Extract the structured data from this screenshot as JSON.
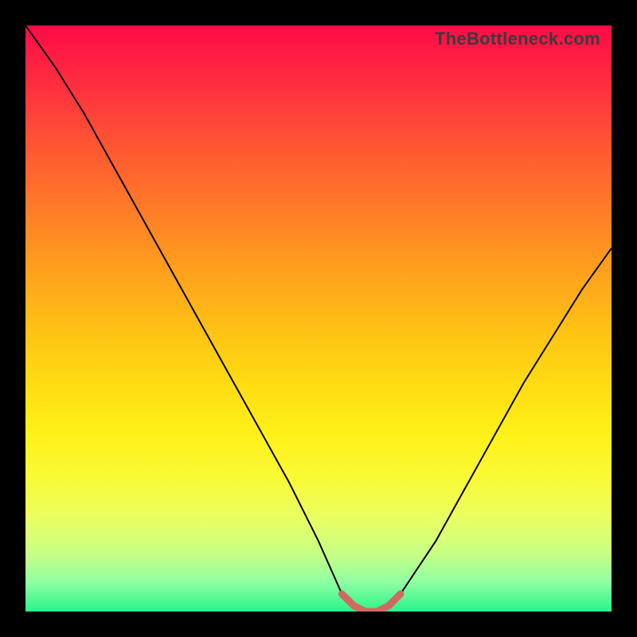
{
  "watermark": "TheBottleneck.com",
  "chart_data": {
    "type": "line",
    "title": "",
    "xlabel": "",
    "ylabel": "",
    "xlim": [
      0,
      100
    ],
    "ylim": [
      0,
      100
    ],
    "series": [
      {
        "name": "main-curve",
        "x": [
          0,
          5,
          10,
          15,
          20,
          25,
          30,
          35,
          40,
          45,
          50,
          54,
          56,
          58,
          60,
          62,
          64,
          70,
          75,
          80,
          85,
          90,
          95,
          100
        ],
        "y": [
          100,
          93,
          85,
          76,
          67,
          58,
          49,
          40,
          31,
          22,
          12,
          3,
          1,
          0,
          0,
          1,
          3,
          12,
          21,
          30,
          39,
          47,
          55,
          62
        ]
      },
      {
        "name": "flat-segment",
        "x": [
          54,
          56,
          58,
          60,
          62,
          64
        ],
        "y": [
          3,
          1,
          0,
          0,
          1,
          3
        ]
      }
    ],
    "colors": {
      "main_curve": "#000000",
      "flat_segment": "#d06a60",
      "gradient_top": "#ff0b47",
      "gradient_bottom": "#29f48b"
    }
  }
}
